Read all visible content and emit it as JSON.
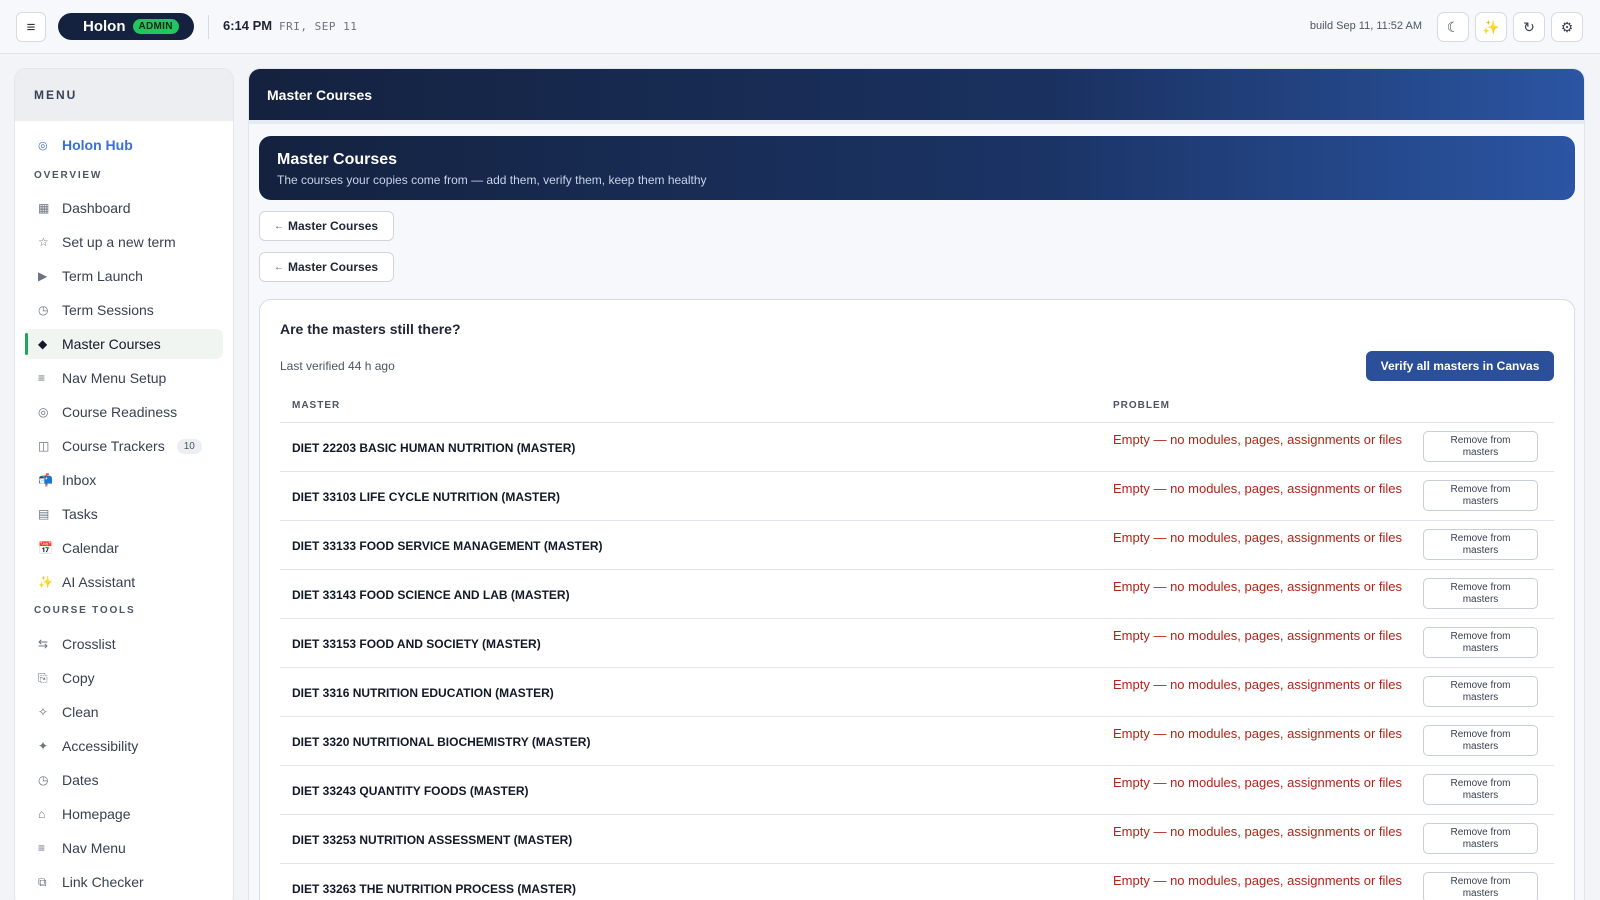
{
  "topbar": {
    "app_name": "Holon",
    "role_badge": "ADMIN",
    "time": "6:14 PM",
    "date": "FRI, SEP 11",
    "build": "build Sep 11, 11:52 AM",
    "buttons": [
      {
        "icon": "moon-icon",
        "glyph": "☾"
      },
      {
        "icon": "sparkles-icon",
        "glyph": "✨"
      },
      {
        "icon": "refresh-icon",
        "glyph": "↻"
      },
      {
        "icon": "gear-icon",
        "glyph": "⚙"
      }
    ]
  },
  "sidebar": {
    "heading": "MENU",
    "hub": {
      "label": "Holon Hub",
      "icon": "◎"
    },
    "sections": {
      "overview": "OVERVIEW",
      "course_tools": "COURSE TOOLS"
    },
    "overview_items": [
      {
        "label": "Dashboard",
        "icon": "▦"
      },
      {
        "label": "Set up a new term",
        "icon": "☆"
      },
      {
        "label": "Term Launch",
        "icon": "▶"
      },
      {
        "label": "Term Sessions",
        "icon": "◷"
      },
      {
        "label": "Master Courses",
        "icon": "◆",
        "active": true
      },
      {
        "label": "Nav Menu Setup",
        "icon": "≡"
      },
      {
        "label": "Course Readiness",
        "icon": "◎"
      },
      {
        "label": "Course Trackers",
        "icon": "◫",
        "badge": "10"
      },
      {
        "label": "Inbox",
        "icon": "📬"
      },
      {
        "label": "Tasks",
        "icon": "▤"
      },
      {
        "label": "Calendar",
        "icon": "📅"
      },
      {
        "label": "AI Assistant",
        "icon": "✨"
      }
    ],
    "tool_items": [
      {
        "label": "Crosslist",
        "icon": "⇆"
      },
      {
        "label": "Copy",
        "icon": "⎘"
      },
      {
        "label": "Clean",
        "icon": "✧"
      },
      {
        "label": "Accessibility",
        "icon": "✦"
      },
      {
        "label": "Dates",
        "icon": "◷"
      },
      {
        "label": "Homepage",
        "icon": "⌂"
      },
      {
        "label": "Nav Menu",
        "icon": "≡"
      },
      {
        "label": "Link Checker",
        "icon": "⧉"
      }
    ]
  },
  "main": {
    "header_title": "Master Courses",
    "hero": {
      "title": "Master Courses",
      "subtitle": "The courses your copies come from — add them, verify them, keep them healthy"
    },
    "back_buttons": [
      "Master Courses",
      "Master Courses"
    ],
    "back_arrow": "←",
    "card": {
      "title": "Are the masters still there?",
      "last_verified": "Last verified 44 h ago",
      "verify_button": "Verify all masters in Canvas",
      "columns": {
        "master": "MASTER",
        "problem": "PROBLEM"
      },
      "rows": [
        {
          "master": "DIET 22203 BASIC HUMAN NUTRITION (MASTER)",
          "problem": "Empty — no modules, pages, assignments or files",
          "action": "Remove from masters"
        },
        {
          "master": "DIET 33103 LIFE CYCLE NUTRITION (MASTER)",
          "problem": "Empty — no modules, pages, assignments or files",
          "action": "Remove from masters"
        },
        {
          "master": "DIET 33133 FOOD SERVICE MANAGEMENT (MASTER)",
          "problem": "Empty — no modules, pages, assignments or files",
          "action": "Remove from masters"
        },
        {
          "master": "DIET 33143 FOOD SCIENCE AND LAB (MASTER)",
          "problem": "Empty — no modules, pages, assignments or files",
          "action": "Remove from masters"
        },
        {
          "master": "DIET 33153 FOOD AND SOCIETY (MASTER)",
          "problem": "Empty — no modules, pages, assignments or files",
          "action": "Remove from masters"
        },
        {
          "master": "DIET 3316 NUTRITION EDUCATION (MASTER)",
          "problem": "Empty — no modules, pages, assignments or files",
          "action": "Remove from masters"
        },
        {
          "master": "DIET 3320 NUTRITIONAL BIOCHEMISTRY (MASTER)",
          "problem": "Empty — no modules, pages, assignments or files",
          "action": "Remove from masters"
        },
        {
          "master": "DIET 33243 QUANTITY FOODS (MASTER)",
          "problem": "Empty — no modules, pages, assignments or files",
          "action": "Remove from masters"
        },
        {
          "master": "DIET 33253 NUTRITION ASSESSMENT (MASTER)",
          "problem": "Empty — no modules, pages, assignments or files",
          "action": "Remove from masters"
        },
        {
          "master": "DIET 33263 THE NUTRITION PROCESS (MASTER)",
          "problem": "Empty — no modules, pages, assignments or files",
          "action": "Remove from masters"
        }
      ]
    }
  },
  "colors": {
    "accent": "#2b4f98",
    "navy": "#14223f",
    "active_indicator": "#22a55a",
    "problem_text": "#b42318",
    "badge_green": "#22c55e"
  }
}
